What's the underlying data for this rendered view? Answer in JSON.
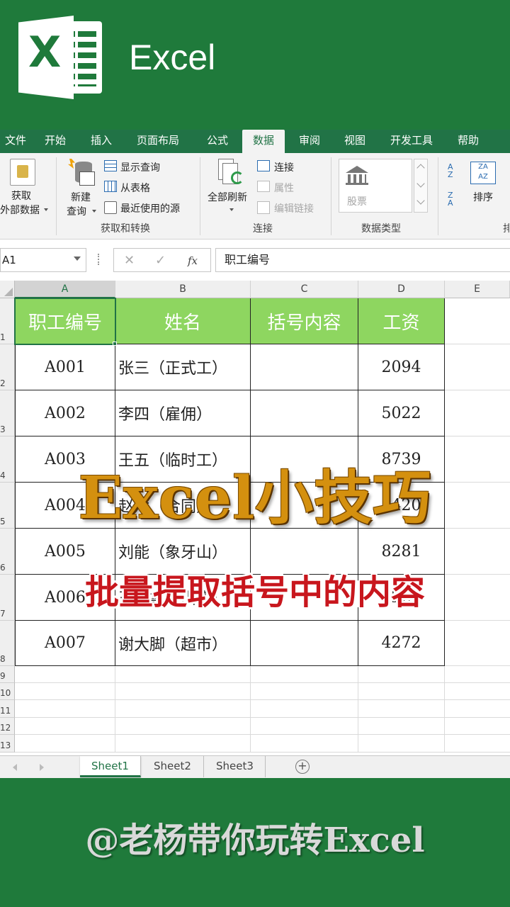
{
  "banner": {
    "app_name": "Excel"
  },
  "ribbon": {
    "tabs": [
      {
        "label": "文件",
        "w": 44
      },
      {
        "label": "开始",
        "w": 68
      },
      {
        "label": "插入",
        "w": 62
      },
      {
        "label": "页面布局",
        "w": 98
      },
      {
        "label": "公式",
        "w": 70
      },
      {
        "label": "数据",
        "w": 60,
        "active": true
      },
      {
        "label": "审阅",
        "w": 70
      },
      {
        "label": "视图",
        "w": 58
      },
      {
        "label": "开发工具",
        "w": 102
      },
      {
        "label": "帮助",
        "w": 58
      }
    ],
    "get_data": {
      "line1": "获取",
      "line2": "外部数据"
    },
    "new_query": {
      "line1": "新建",
      "line2": "查询"
    },
    "show_query": "显示查询",
    "from_table": "从表格",
    "recent_sources": "最近使用的源",
    "group_get_transform": "获取和转换",
    "refresh_all": "全部刷新",
    "connections": "连接",
    "properties": "属性",
    "edit_links": "编辑链接",
    "group_connections": "连接",
    "stocks": "股票",
    "group_data_types": "数据类型",
    "sort": "排序",
    "group_cut": "排"
  },
  "formula_bar": {
    "name_box": "A1",
    "cancel": "✕",
    "enter": "✓",
    "fx": "fx",
    "content": "职工编号"
  },
  "grid": {
    "columns": [
      "A",
      "B",
      "C",
      "D",
      "E"
    ],
    "rows": [
      "1",
      "2",
      "3",
      "4",
      "5",
      "6",
      "7",
      "8",
      "9",
      "10",
      "11",
      "12",
      "13"
    ],
    "headers": [
      "职工编号",
      "姓名",
      "括号内容",
      "工资"
    ],
    "data": [
      [
        "A001",
        "张三（正式工）",
        "",
        "2094"
      ],
      [
        "A002",
        "李四（雇佣）",
        "",
        "5022"
      ],
      [
        "A003",
        "王五（临时工）",
        "",
        "8739"
      ],
      [
        "A004",
        "赵六（合同）",
        "",
        "3420"
      ],
      [
        "A005",
        "刘能（象牙山）",
        "",
        "8281"
      ],
      [
        "A006",
        "王大拿（山庄）",
        "",
        "2227"
      ],
      [
        "A007",
        "谢大脚（超市）",
        "",
        "4272"
      ]
    ]
  },
  "sheets": {
    "tabs": [
      "Sheet1",
      "Sheet2",
      "Sheet3"
    ],
    "active": "Sheet1",
    "add": "+"
  },
  "overlay": {
    "title": "Excel小技巧",
    "subtitle": "批量提取括号中的内容"
  },
  "footer": {
    "text": "@老杨带你玩转Excel"
  },
  "colors": {
    "excel_green": "#217346",
    "header_fill": "#8ed660",
    "title_orange": "#d4900f",
    "subtitle_red": "#c8161d"
  }
}
